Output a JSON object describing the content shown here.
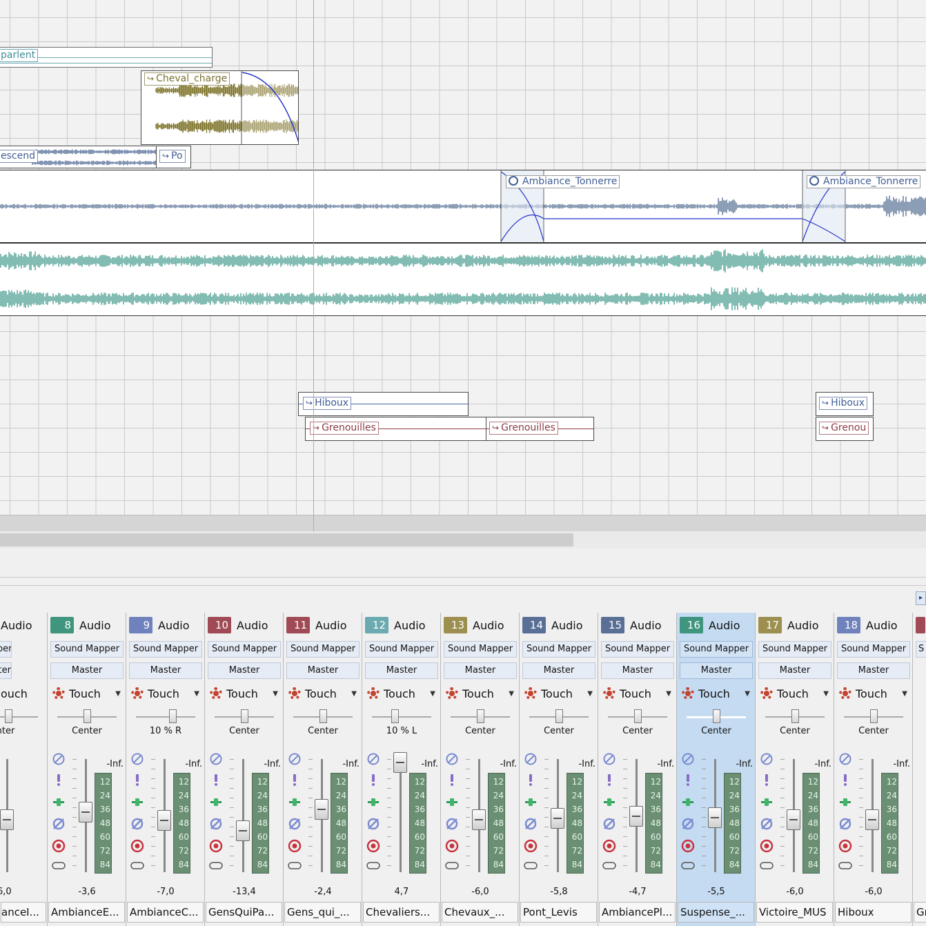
{
  "timeline": {
    "clips": {
      "parlent": "parlent",
      "cheval_charge": "Cheval_charge",
      "escend": "escend",
      "po": "Po",
      "ambiance_tonnerre_1": "Ambiance_Tonnerre",
      "ambiance_tonnerre_2": "Ambiance_Tonnerre",
      "hiboux_1": "Hiboux",
      "hiboux_2": "Hiboux",
      "grenouilles_1": "Grenouilles",
      "grenouilles_2": "Grenouilles",
      "grenouilles_3": "Grenou"
    }
  },
  "mixer": {
    "partial_left": {
      "kind": "Audio",
      "output": "d Mapper",
      "bus": "aster",
      "automation": "ouch",
      "pan": "enter",
      "volume": "-6,0",
      "name": "anceI..."
    },
    "strips": [
      {
        "num": "8",
        "color": "#3f957e",
        "kind": "Audio",
        "output": "Sound Mapper",
        "bus": "Master",
        "automation": "Touch",
        "pan": "Center",
        "inf": "-Inf.",
        "volume": "-3,6",
        "name": "AmbianceE..."
      },
      {
        "num": "9",
        "color": "#6f82bd",
        "kind": "Audio",
        "output": "Sound Mapper",
        "bus": "Master",
        "automation": "Touch",
        "pan": "10 % R",
        "inf": "-Inf.",
        "volume": "-7,0",
        "name": "AmbianceC..."
      },
      {
        "num": "10",
        "color": "#a04a55",
        "kind": "Audio",
        "output": "Sound Mapper",
        "bus": "Master",
        "automation": "Touch",
        "pan": "Center",
        "inf": "-Inf.",
        "volume": "-13,4",
        "name": "GensQuiPa..."
      },
      {
        "num": "11",
        "color": "#a04a55",
        "kind": "Audio",
        "output": "Sound Mapper",
        "bus": "Master",
        "automation": "Touch",
        "pan": "Center",
        "inf": "-Inf.",
        "volume": "-2,4",
        "name": "Gens_qui_..."
      },
      {
        "num": "12",
        "color": "#6aaab0",
        "kind": "Audio",
        "output": "Sound Mapper",
        "bus": "Master",
        "automation": "Touch",
        "pan": "10 % L",
        "inf": "-Inf.",
        "volume": "4,7",
        "name": "Chevaliers..."
      },
      {
        "num": "13",
        "color": "#9c8f4f",
        "kind": "Audio",
        "output": "Sound Mapper",
        "bus": "Master",
        "automation": "Touch",
        "pan": "Center",
        "inf": "-Inf.",
        "volume": "-6,0",
        "name": "Chevaux_..."
      },
      {
        "num": "14",
        "color": "#5a6f96",
        "kind": "Audio",
        "output": "Sound Mapper",
        "bus": "Master",
        "automation": "Touch",
        "pan": "Center",
        "inf": "-Inf.",
        "volume": "-5,8",
        "name": "Pont_Levis"
      },
      {
        "num": "15",
        "color": "#5a6f96",
        "kind": "Audio",
        "output": "Sound Mapper",
        "bus": "Master",
        "automation": "Touch",
        "pan": "Center",
        "inf": "-Inf.",
        "volume": "-4,7",
        "name": "AmbiancePl..."
      },
      {
        "num": "16",
        "color": "#3f957e",
        "kind": "Audio",
        "output": "Sound Mapper",
        "bus": "Master",
        "automation": "Touch",
        "pan": "Center",
        "inf": "-Inf.",
        "volume": "-5,5",
        "name": "Suspense_...",
        "selected": true
      },
      {
        "num": "17",
        "color": "#9c8f4f",
        "kind": "Audio",
        "output": "Sound Mapper",
        "bus": "Master",
        "automation": "Touch",
        "pan": "Center",
        "inf": "-Inf.",
        "volume": "-6,0",
        "name": "Victoire_MUS"
      },
      {
        "num": "18",
        "color": "#6f82bd",
        "kind": "Audio",
        "output": "Sound Mapper",
        "bus": "Master",
        "automation": "Touch",
        "pan": "Center",
        "inf": "-Inf.",
        "volume": "-6,0",
        "name": "Hiboux"
      }
    ],
    "partial_right": {
      "color": "#a04a55",
      "output": "S",
      "name": "Gr"
    },
    "meter_scale": [
      "12",
      "24",
      "36",
      "48",
      "60",
      "72",
      "84"
    ]
  }
}
